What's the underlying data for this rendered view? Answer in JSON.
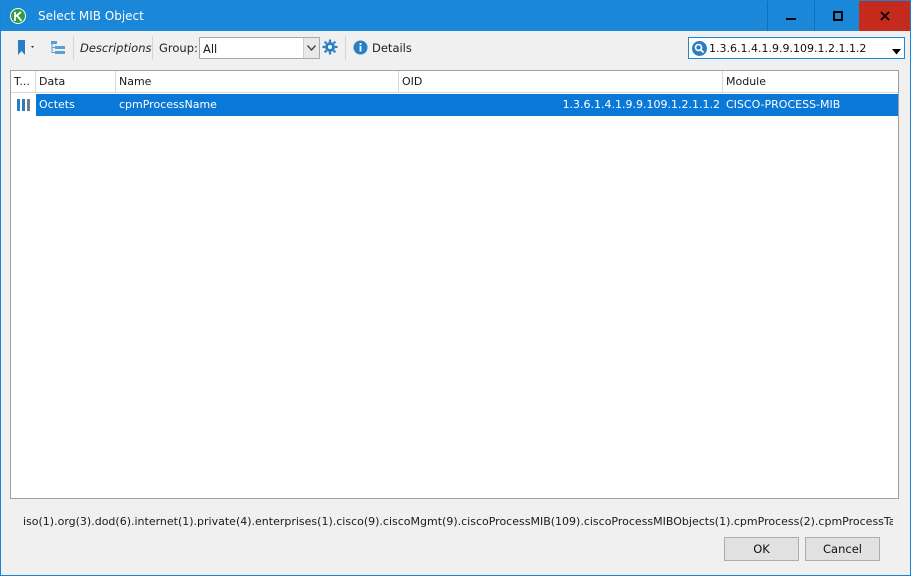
{
  "window": {
    "title": "Select MIB Object",
    "controls": {
      "minimize_icon": "minimize-icon",
      "maximize_icon": "maximize-icon",
      "close_icon": "close-icon"
    }
  },
  "toolbar": {
    "descriptions_label": "Descriptions",
    "group_label": "Group:",
    "group_value": "All",
    "details_label": "Details",
    "search_value": "1.3.6.1.4.1.9.9.109.1.2.1.1.2"
  },
  "table": {
    "columns": [
      "T...",
      "Data",
      "Name",
      "OID",
      "Module"
    ],
    "rows": [
      {
        "data": "Octets",
        "name": "cpmProcessName",
        "oid": "1.3.6.1.4.1.9.9.109.1.2.1.1.2",
        "module": "CISCO-PROCESS-MIB",
        "selected": true
      }
    ]
  },
  "footer": {
    "oid_path": "iso(1).org(3).dod(6).internet(1).private(4).enterprises(1).cisco(9).ciscoMgmt(9).ciscoProcessMIB(109).ciscoProcessMIBObjects(1).cpmProcess(2).cpmProcessTable(1).cpmProc...",
    "ok_label": "OK",
    "cancel_label": "Cancel"
  },
  "colors": {
    "titlebar": "#1a87d8",
    "selection": "#0a78d7",
    "close_button": "#c42b1c"
  }
}
